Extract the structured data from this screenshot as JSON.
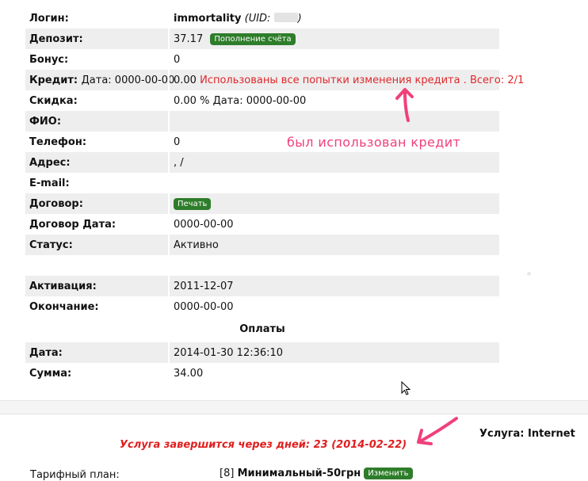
{
  "account": {
    "login_label": "Логин:",
    "login_value": "immortality",
    "uid_label": "(UID:",
    "uid_close": ")",
    "deposit_label": "Депозит:",
    "deposit_value": "37.17",
    "topup_button": "Пополнение счёта",
    "bonus_label": "Бонус:",
    "bonus_value": "0",
    "credit_label": "Кредит:",
    "credit_date_label": "Дата: 0000-00-00",
    "credit_value": "0.00",
    "credit_warning": "Использованы все попытки изменения кредита . Всего: 2/1",
    "discount_label": "Скидка:",
    "discount_value": "0.00 % Дата: 0000-00-00",
    "fio_label": "ФИО:",
    "fio_value": "",
    "phone_label": "Телефон:",
    "phone_value": "0",
    "address_label": "Адрес:",
    "address_value": ", /",
    "email_label": "E-mail:",
    "email_value": "",
    "contract_label": "Договор:",
    "print_button": "Печать",
    "contract_date_label": "Договор Дата:",
    "contract_date_value": "0000-00-00",
    "status_label": "Статус:",
    "status_value": "Активно",
    "activation_label": "Активация:",
    "activation_value": "2011-12-07",
    "end_label": "Окончание:",
    "end_value": "0000-00-00"
  },
  "payments": {
    "header": "Оплаты",
    "date_label": "Дата:",
    "date_value": "2014-01-30 12:36:10",
    "sum_label": "Сумма:",
    "sum_value": "34.00"
  },
  "annotation": {
    "credit_note": "был использован кредит"
  },
  "service": {
    "warning": "Услуга завершится через дней: 23 (2014-02-22)",
    "label": "Услуга: Internet",
    "tariff_label": "Тарифный план:",
    "tariff_id": "[8]",
    "tariff_name": "Минимальный-50грн",
    "change_button": "Изменить"
  },
  "colors": {
    "button_green": "#2e7d2a",
    "warning_red": "#e0272a",
    "annotation_pink": "#f0407a"
  }
}
